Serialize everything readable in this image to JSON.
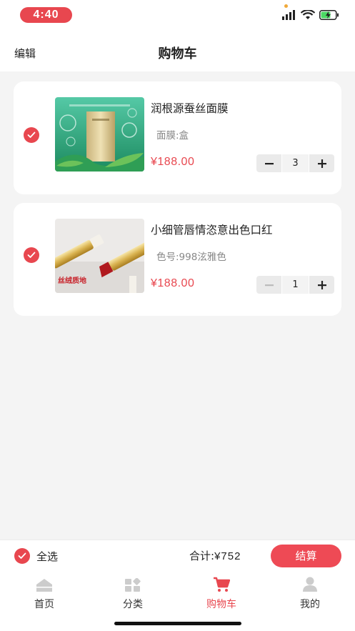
{
  "status_bar": {
    "time": "4:40"
  },
  "nav": {
    "edit_label": "编辑",
    "title": "购物车"
  },
  "cart_items": [
    {
      "name": "润根源蚕丝面膜",
      "spec": "面膜:盒",
      "price": "¥188.00",
      "quantity": "3",
      "checked": true,
      "minus_enabled": true
    },
    {
      "name": "小细管唇情恣意出色口红",
      "spec": "色号:998泫雅色",
      "price": "¥188.00",
      "quantity": "1",
      "checked": true,
      "minus_enabled": false
    }
  ],
  "product_image_text": {
    "lipstick_banner": "丝绒质地"
  },
  "bottom_bar": {
    "select_all_label": "全选",
    "total_label": "合计:",
    "total_amount": "¥752",
    "checkout_label": "结算"
  },
  "tabs": [
    {
      "label": "首页",
      "icon": "home-icon",
      "active": false
    },
    {
      "label": "分类",
      "icon": "category-icon",
      "active": false
    },
    {
      "label": "购物车",
      "icon": "cart-icon",
      "active": true
    },
    {
      "label": "我的",
      "icon": "profile-icon",
      "active": false
    }
  ],
  "colors": {
    "accent": "#e8474f",
    "background": "#f4f4f4",
    "tab_inactive": "#cccccc"
  }
}
